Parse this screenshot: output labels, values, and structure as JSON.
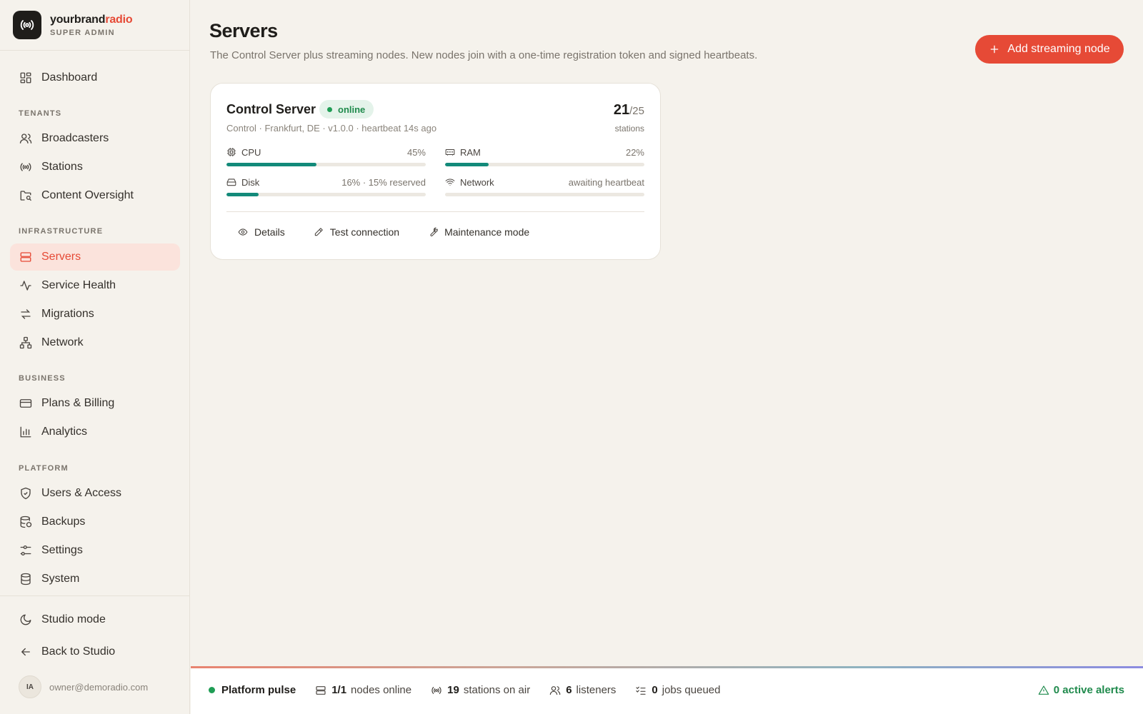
{
  "brand": {
    "name_main": "yourbrand",
    "name_accent": "radio",
    "role": "SUPER ADMIN"
  },
  "nav": {
    "dashboard": "Dashboard",
    "sections": {
      "tenants": "TENANTS",
      "infrastructure": "INFRASTRUCTURE",
      "business": "BUSINESS",
      "platform": "PLATFORM"
    },
    "broadcasters": "Broadcasters",
    "stations": "Stations",
    "content_oversight": "Content Oversight",
    "servers": "Servers",
    "service_health": "Service Health",
    "migrations": "Migrations",
    "network": "Network",
    "plans_billing": "Plans & Billing",
    "analytics": "Analytics",
    "users_access": "Users & Access",
    "backups": "Backups",
    "settings": "Settings",
    "system": "System",
    "studio_mode": "Studio mode",
    "back_to_studio": "Back to Studio"
  },
  "user": {
    "initials": "IA",
    "email": "owner@demoradio.com"
  },
  "page": {
    "title": "Servers",
    "subtitle": "The Control Server plus streaming nodes. New nodes join with a one-time registration token and signed heartbeats.",
    "add_button": "Add streaming node"
  },
  "server_card": {
    "name": "Control Server",
    "status": "online",
    "meta": "Control · Frankfurt, DE · v1.0.0 · heartbeat 14s ago",
    "stations_used": "21",
    "stations_total": "/25",
    "stations_label": "stations",
    "metrics": {
      "cpu": {
        "label": "CPU",
        "value": "45%",
        "fill": 0.45
      },
      "ram": {
        "label": "RAM",
        "value": "22%",
        "fill": 0.22
      },
      "disk": {
        "label": "Disk",
        "value": "16% · 15% reserved",
        "fill": 0.16
      },
      "network": {
        "label": "Network",
        "value": "awaiting heartbeat",
        "fill": 0
      }
    },
    "actions": {
      "details": "Details",
      "test_connection": "Test connection",
      "maintenance": "Maintenance mode"
    }
  },
  "pulse": {
    "title": "Platform pulse",
    "nodes_value": "1/1",
    "nodes_label": "nodes online",
    "stations_value": "19",
    "stations_label": "stations on air",
    "listeners_value": "6",
    "listeners_label": "listeners",
    "jobs_value": "0",
    "jobs_label": "jobs queued",
    "alerts": "0 active alerts"
  },
  "colors": {
    "accent": "#e64a36",
    "success": "#1f9d55",
    "bar": "#138a7a"
  }
}
